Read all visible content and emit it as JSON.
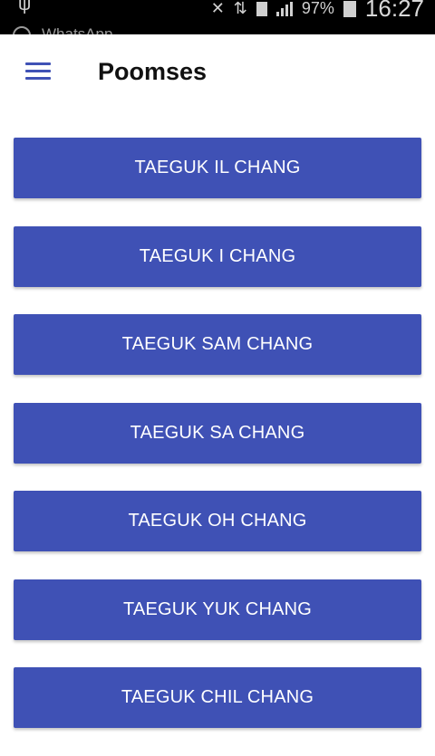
{
  "status_bar": {
    "battery": "97%",
    "time": "16:27",
    "notification_app": "WhatsApp",
    "usb_icon": "usb-icon",
    "mute_icon": "notifications-off-icon",
    "data_icon": "data-transfer-icon",
    "signal_icon": "signal-icon",
    "battery_icon": "battery-charging-icon"
  },
  "app_bar": {
    "title": "Poomses",
    "menu_icon": "hamburger-menu-icon"
  },
  "poomses": [
    {
      "label": "TAEGUK IL CHANG"
    },
    {
      "label": "TAEGUK I CHANG"
    },
    {
      "label": "TAEGUK SAM CHANG"
    },
    {
      "label": "TAEGUK SA CHANG"
    },
    {
      "label": "TAEGUK OH CHANG"
    },
    {
      "label": "TAEGUK YUK CHANG"
    },
    {
      "label": "TAEGUK CHIL CHANG"
    }
  ],
  "colors": {
    "primary": "#3f51b5",
    "button_text": "#ffffff",
    "title_text": "#111111",
    "status_bar": "#000000"
  }
}
